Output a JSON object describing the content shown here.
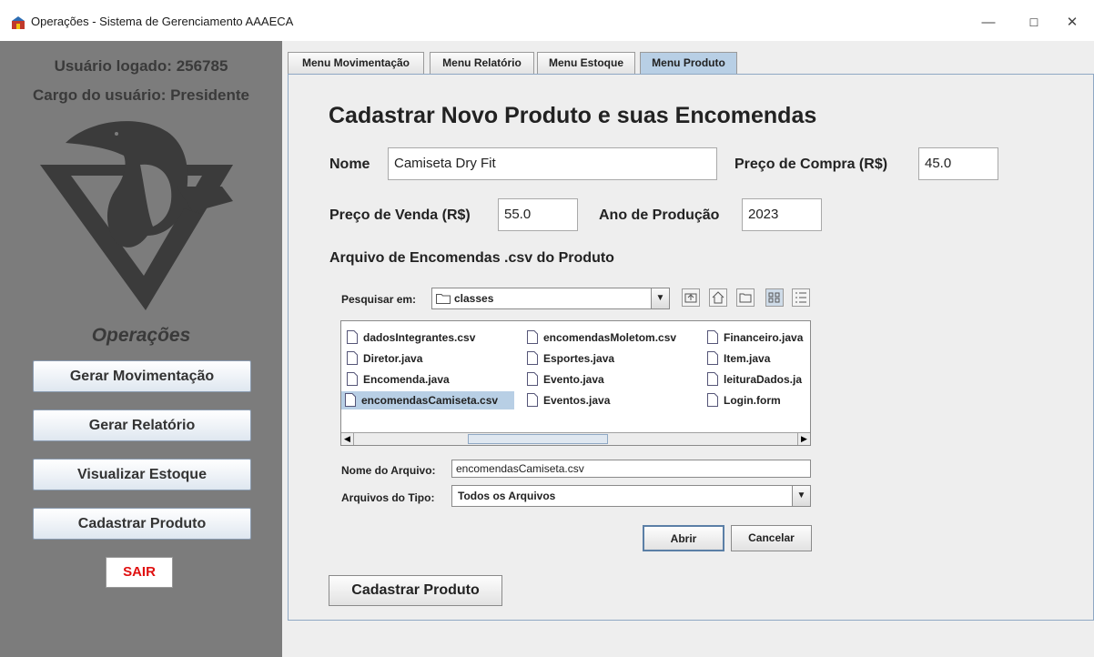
{
  "window": {
    "title": "Operações - Sistema de Gerenciamento AAAECA",
    "minimize": "—",
    "maximize": "☐",
    "close": "✕"
  },
  "sidebar": {
    "user_logged": "Usuário logado: 256785",
    "user_role": "Cargo do usuário: Presidente",
    "operations_title": "Operações",
    "buttons": [
      "Gerar Movimentação",
      "Gerar Relatório",
      "Visualizar Estoque",
      "Cadastrar Produto"
    ],
    "logout": "SAIR"
  },
  "tabs": [
    {
      "label": "Menu Movimentação",
      "active": false
    },
    {
      "label": "Menu Relatório",
      "active": false
    },
    {
      "label": "Menu Estoque",
      "active": false
    },
    {
      "label": "Menu Produto",
      "active": true
    }
  ],
  "form": {
    "heading": "Cadastrar Novo Produto e suas Encomendas",
    "nome_label": "Nome",
    "nome_value": "Camiseta Dry Fit",
    "preco_compra_label": "Preço de Compra (R$)",
    "preco_compra_value": "45.0",
    "preco_venda_label": "Preço de Venda (R$)",
    "preco_venda_value": "55.0",
    "ano_label": "Ano de Produção",
    "ano_value": "2023",
    "arquivo_label": "Arquivo de Encomendas .csv do Produto",
    "submit": "Cadastrar Produto"
  },
  "file_chooser": {
    "look_in_label": "Pesquisar em:",
    "look_in_value": "classes",
    "files": [
      {
        "name": "dadosIntegrantes.csv",
        "selected": false
      },
      {
        "name": "Diretor.java",
        "selected": false
      },
      {
        "name": "Encomenda.java",
        "selected": false
      },
      {
        "name": "encomendasCamiseta.csv",
        "selected": true
      },
      {
        "name": "encomendasMoletom.csv",
        "selected": false
      },
      {
        "name": "Esportes.java",
        "selected": false
      },
      {
        "name": "Evento.java",
        "selected": false
      },
      {
        "name": "Eventos.java",
        "selected": false
      },
      {
        "name": "Financeiro.java",
        "selected": false
      },
      {
        "name": "Item.java",
        "selected": false
      },
      {
        "name": "leituraDados.ja",
        "selected": false
      },
      {
        "name": "Login.form",
        "selected": false
      }
    ],
    "filename_label": "Nome do Arquivo:",
    "filename_value": "encomendasCamiseta.csv",
    "filetype_label": "Arquivos do Tipo:",
    "filetype_value": "Todos os Arquivos",
    "open_button": "Abrir",
    "cancel_button": "Cancelar"
  },
  "colors": {
    "sidebar_bg": "#7c7c7c",
    "selection": "#b8cfe5",
    "logout_text": "#e01010"
  }
}
